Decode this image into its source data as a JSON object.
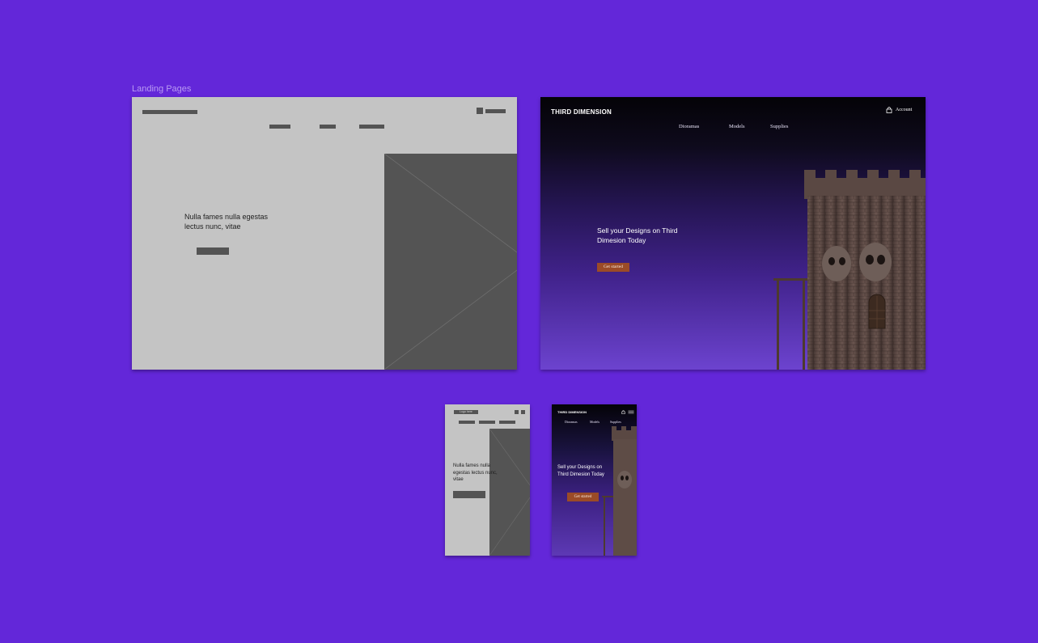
{
  "canvas": {
    "section_label": "Landing Pages",
    "background_color": "#6327d9"
  },
  "desktop_wireframe": {
    "hero_text": "Nulla fames nulla egestas lectus nunc, vitae"
  },
  "desktop_design": {
    "brand": "THIRD DIMENSION",
    "account_label": "Account",
    "account_icon": "bag-icon",
    "nav": [
      "Dioramas",
      "Models",
      "Supplies"
    ],
    "hero_title": "Sell your Designs on Third Dimesion Today",
    "cta_label": "Get started",
    "accent_color": "#9b4b27"
  },
  "mobile_wireframe": {
    "logo_label": "Logo here",
    "hero_text": "Nulla fames nulla egestas lectus nunc, vitae"
  },
  "mobile_design": {
    "brand": "THIRD DIMENSION",
    "nav": [
      "Dioramas",
      "Models",
      "Supplies"
    ],
    "hero_title": "Sell your Designs on Third Dimesion Today",
    "cta_label": "Get started"
  }
}
